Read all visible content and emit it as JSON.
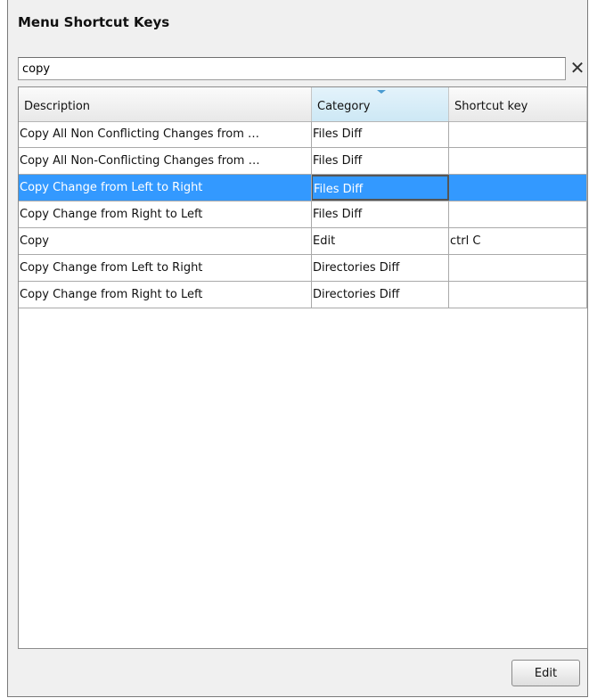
{
  "dialog": {
    "title": "Menu Shortcut Keys"
  },
  "search": {
    "value": "copy",
    "clear_icon": "close-icon",
    "clear_glyph": "✕"
  },
  "table": {
    "columns": [
      {
        "label": "Description"
      },
      {
        "label": "Category",
        "sorted": true,
        "sort_direction": "descending"
      },
      {
        "label": "Shortcut key"
      }
    ],
    "rows": [
      {
        "description": "Copy All Non Conflicting Changes from …",
        "category": "Files Diff",
        "shortcut": "",
        "selected": false
      },
      {
        "description": "Copy All Non-Conflicting Changes from …",
        "category": "Files Diff",
        "shortcut": "",
        "selected": false
      },
      {
        "description": "Copy Change from Left to Right",
        "category": "Files Diff",
        "shortcut": "",
        "selected": true
      },
      {
        "description": "Copy Change from Right to Left",
        "category": "Files Diff",
        "shortcut": "",
        "selected": false
      },
      {
        "description": "Copy",
        "category": "Edit",
        "shortcut": "ctrl C",
        "selected": false
      },
      {
        "description": "Copy Change from Left to Right",
        "category": "Directories Diff",
        "shortcut": "",
        "selected": false
      },
      {
        "description": "Copy Change from Right to Left",
        "category": "Directories Diff",
        "shortcut": "",
        "selected": false
      }
    ]
  },
  "footer": {
    "edit_label": "Edit"
  },
  "colors": {
    "selection": "#3399ff",
    "sort_indicator": "#4a9bd1",
    "panel_background": "#f0f0f0"
  }
}
